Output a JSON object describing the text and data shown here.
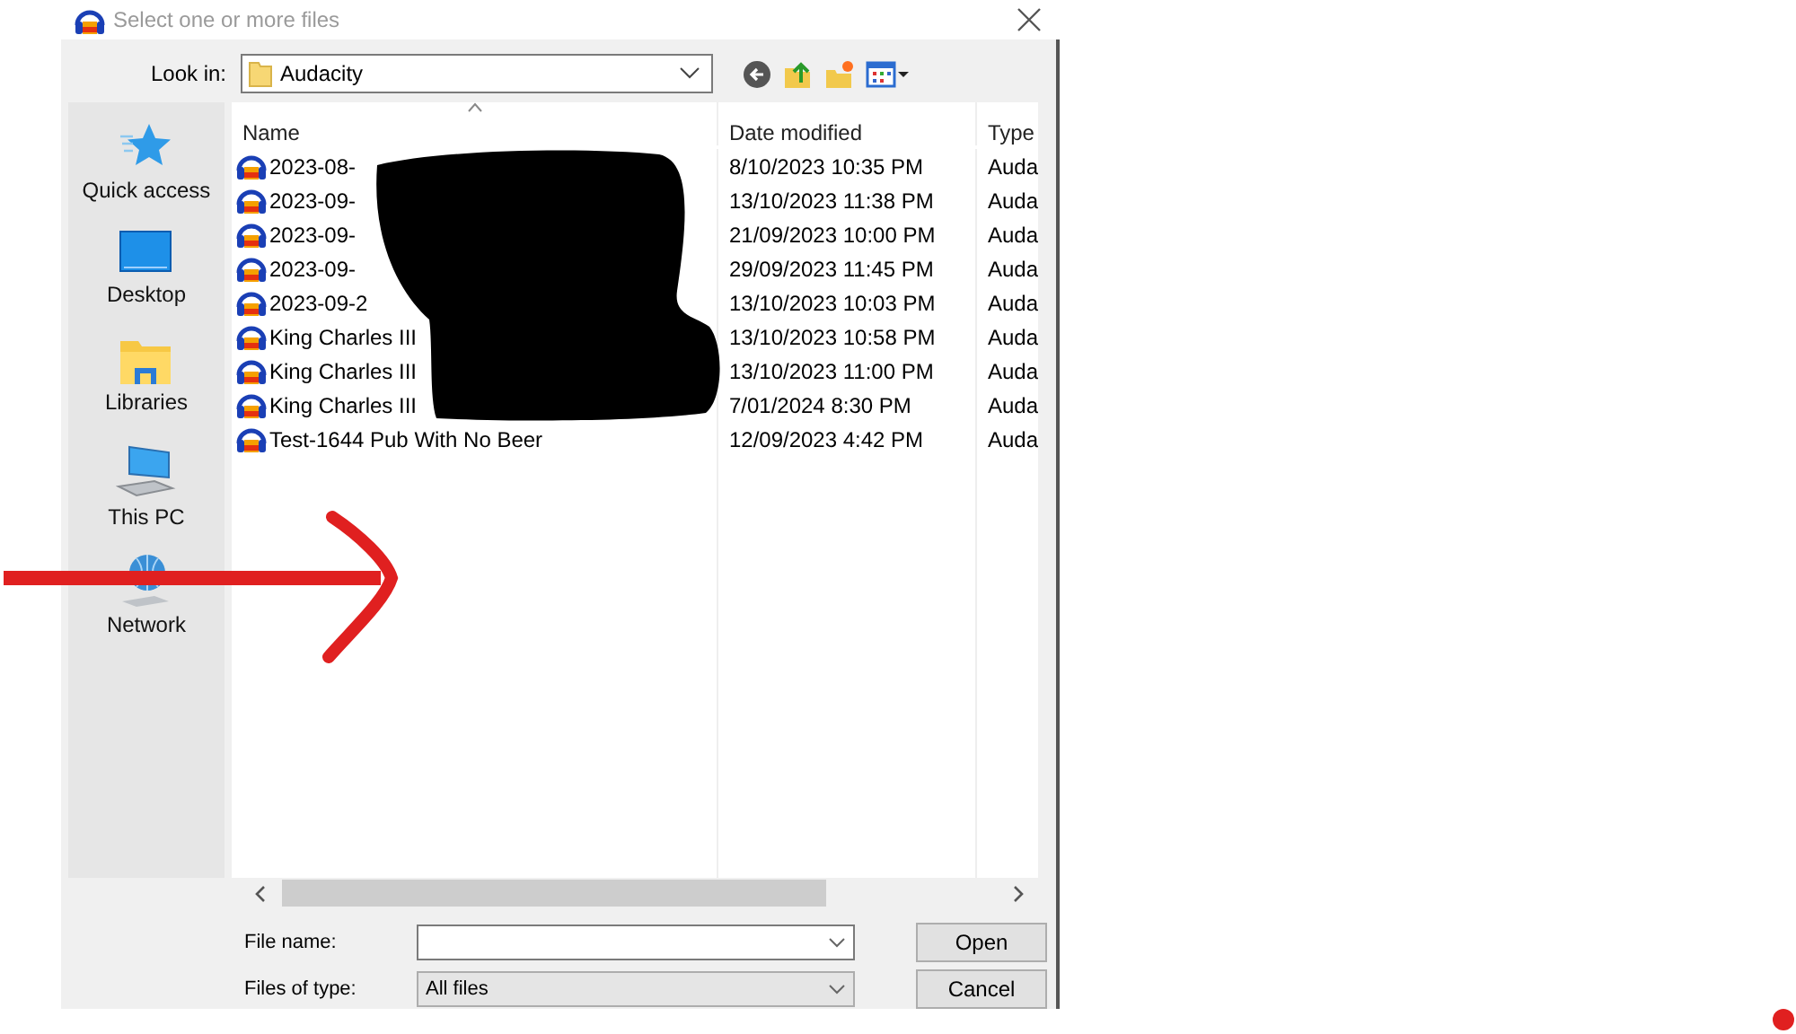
{
  "window": {
    "title": "Select one or more files"
  },
  "look_in": {
    "label": "Look in:",
    "value": "Audacity"
  },
  "sidebar": {
    "items": [
      {
        "label": "Quick access",
        "kind": "star"
      },
      {
        "label": "Desktop",
        "kind": "desktop"
      },
      {
        "label": "Libraries",
        "kind": "libraries"
      },
      {
        "label": "This PC",
        "kind": "pc"
      },
      {
        "label": "Network",
        "kind": "network"
      }
    ]
  },
  "table": {
    "columns": [
      "Name",
      "Date modified",
      "Type"
    ],
    "rows": [
      {
        "name": "2023-08-",
        "date": "8/10/2023 10:35 PM",
        "type": "Auda"
      },
      {
        "name": "2023-09-",
        "date": "13/10/2023 11:38 PM",
        "type": "Auda"
      },
      {
        "name": "2023-09-",
        "date": "21/09/2023 10:00 PM",
        "type": "Auda"
      },
      {
        "name": "2023-09-",
        "date": "29/09/2023 11:45 PM",
        "type": "Auda"
      },
      {
        "name": "2023-09-2",
        "date": "13/10/2023 10:03 PM",
        "type": "Auda"
      },
      {
        "name": "King Charles III",
        "date": "13/10/2023 10:58 PM",
        "type": "Auda"
      },
      {
        "name": "King Charles III",
        "date": "13/10/2023 11:00 PM",
        "type": "Auda"
      },
      {
        "name": "King Charles III",
        "date": "7/01/2024 8:30 PM",
        "type": "Auda"
      },
      {
        "name": "Test-1644 Pub With No Beer",
        "date": "12/09/2023 4:42 PM",
        "type": "Auda"
      }
    ]
  },
  "file_name": {
    "label": "File name:"
  },
  "file_type": {
    "label": "Files of type:",
    "value": "All files"
  },
  "buttons": [
    "Open",
    "Cancel"
  ]
}
